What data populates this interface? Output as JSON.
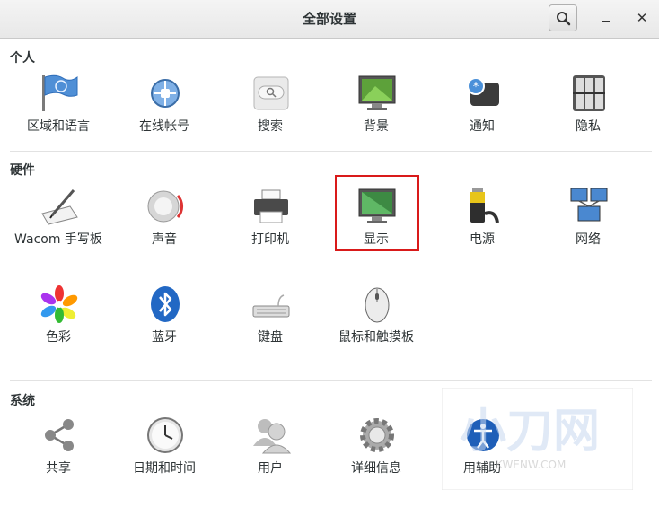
{
  "window": {
    "title": "全部设置"
  },
  "sections": {
    "personal": {
      "label": "个人",
      "items": [
        "区域和语言",
        "在线帐号",
        "搜索",
        "背景",
        "通知",
        "隐私"
      ]
    },
    "hardware": {
      "label": "硬件",
      "items": [
        "Wacom 手写板",
        "声音",
        "打印机",
        "显示",
        "电源",
        "网络",
        "色彩",
        "蓝牙",
        "键盘",
        "鼠标和触摸板"
      ]
    },
    "system": {
      "label": "系统",
      "items": [
        "共享",
        "日期和时间",
        "用户",
        "详细信息",
        "用辅助"
      ]
    }
  },
  "highlighted_item": "显示",
  "watermark": {
    "logo_text": "小刀网",
    "url_text": "KWENW.COM"
  },
  "icons": {
    "personal": [
      "flag-icon",
      "online-accounts-icon",
      "search-icon",
      "background-icon",
      "notification-icon",
      "privacy-icon"
    ],
    "hardware": [
      "wacom-tablet-icon",
      "sound-icon",
      "printer-icon",
      "display-icon",
      "power-icon",
      "network-icon",
      "color-icon",
      "bluetooth-icon",
      "keyboard-icon",
      "mouse-icon"
    ],
    "system": [
      "sharing-icon",
      "date-time-icon",
      "users-icon",
      "details-icon",
      "accessibility-icon"
    ]
  }
}
